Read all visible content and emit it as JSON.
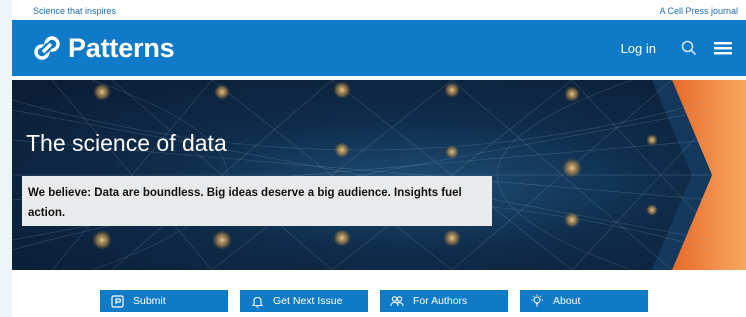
{
  "topbar": {
    "tagline": "Science that inspires",
    "journal": "A Cell Press journal"
  },
  "header": {
    "brand": "Patterns",
    "login": "Log in",
    "icons": [
      "logo-icon",
      "search-icon",
      "menu-icon"
    ]
  },
  "hero": {
    "title": "The science of data",
    "statement": "We believe: Data are boundless. Big ideas deserve a big audience. Insights fuel action."
  },
  "actions": [
    {
      "label": "Submit",
      "icon": "submit-icon"
    },
    {
      "label": "Get Next Issue",
      "icon": "bell-icon"
    },
    {
      "label": "For Authors",
      "icon": "users-icon"
    },
    {
      "label": "About",
      "icon": "lightbulb-icon"
    }
  ],
  "colors": {
    "brand_blue": "#0f7ac7",
    "hero_dark": "#0f2c4a",
    "hero_accent": "#f28a3b"
  }
}
